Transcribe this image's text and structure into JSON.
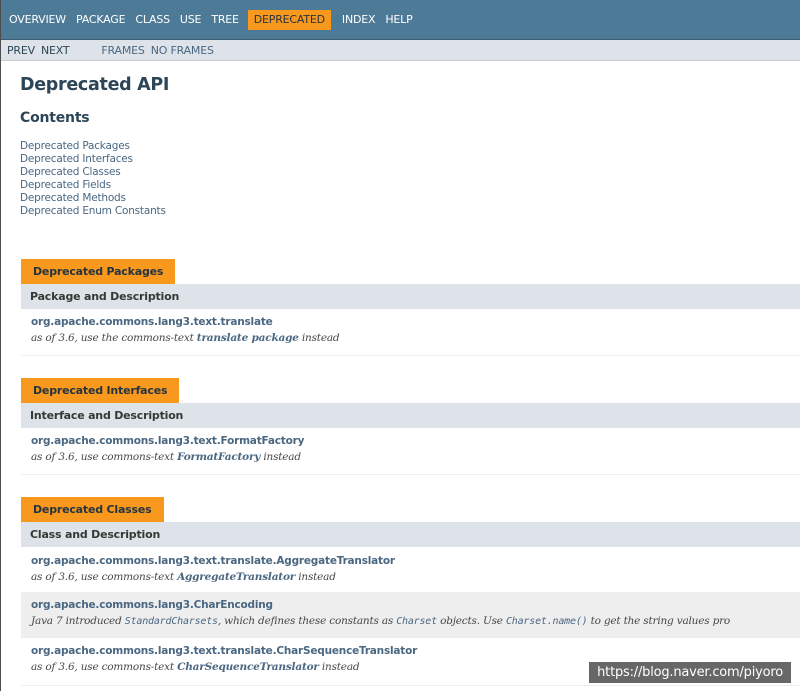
{
  "topnav": {
    "items": [
      "OVERVIEW",
      "PACKAGE",
      "CLASS",
      "USE",
      "TREE",
      "DEPRECATED",
      "INDEX",
      "HELP"
    ],
    "active": "DEPRECATED"
  },
  "subnav": {
    "prev": "PREV",
    "next": "NEXT",
    "frames": "FRAMES",
    "no_frames": "NO FRAMES"
  },
  "page": {
    "title": "Deprecated API",
    "contents_heading": "Contents",
    "toc": [
      "Deprecated Packages",
      "Deprecated Interfaces",
      "Deprecated Classes",
      "Deprecated Fields",
      "Deprecated Methods",
      "Deprecated Enum Constants"
    ]
  },
  "sections": {
    "packages": {
      "caption": "Deprecated Packages",
      "column": "Package and Description",
      "rows": [
        {
          "name": "org.apache.commons.lang3.text.translate",
          "desc_pre": "as of 3.6, use the commons-text ",
          "desc_link": "translate package",
          "desc_post": " instead"
        }
      ]
    },
    "interfaces": {
      "caption": "Deprecated Interfaces",
      "column": "Interface and Description",
      "rows": [
        {
          "name": "org.apache.commons.lang3.text.FormatFactory",
          "desc_pre": "as of 3.6, use commons-text ",
          "desc_link": "FormatFactory",
          "desc_post": " instead"
        }
      ]
    },
    "classes": {
      "caption": "Deprecated Classes",
      "column": "Class and Description",
      "rows": [
        {
          "name": "org.apache.commons.lang3.text.translate.AggregateTranslator",
          "desc_pre": "as of 3.6, use commons-text ",
          "desc_link": "AggregateTranslator",
          "desc_post": " instead"
        },
        {
          "name": "org.apache.commons.lang3.CharEncoding",
          "desc_a": "Java 7 introduced ",
          "code_a": "StandardCharsets",
          "desc_b": ", which defines these constants as ",
          "code_b": "Charset",
          "desc_c": " objects. Use ",
          "code_c": "Charset.name()",
          "desc_d": " to get the string values pro"
        },
        {
          "name": "org.apache.commons.lang3.text.translate.CharSequenceTranslator",
          "desc_pre": "as of 3.6, use commons-text ",
          "desc_link": "CharSequenceTranslator",
          "desc_post": " instead"
        }
      ]
    }
  },
  "watermark": "https://blog.naver.com/piyoro"
}
